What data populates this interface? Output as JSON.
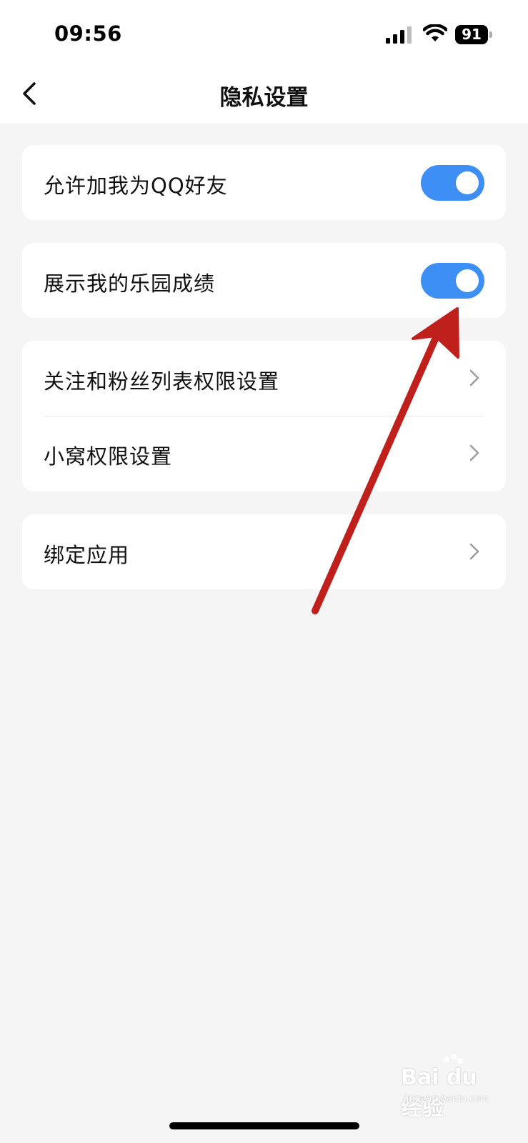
{
  "status_bar": {
    "time": "09:56",
    "battery_level": "91",
    "icons": [
      "signal-icon",
      "wifi-icon",
      "battery-icon"
    ]
  },
  "nav": {
    "title": "隐私设置",
    "back_icon": "chevron-left-icon"
  },
  "settings": {
    "toggles": [
      {
        "label": "允许加我为QQ好友",
        "on": true
      },
      {
        "label": "展示我的乐园成绩",
        "on": true
      }
    ],
    "links": [
      {
        "label": "关注和粉丝列表权限设置"
      },
      {
        "label": "小窝权限设置"
      },
      {
        "label": "绑定应用"
      }
    ]
  },
  "colors": {
    "toggle_on": "#3d8ff5",
    "annotation_arrow": "#c0201c",
    "background": "#f5f5f5"
  },
  "watermark": {
    "brand": "Bai du 经验",
    "sub": "jingyan.baidu.com"
  }
}
